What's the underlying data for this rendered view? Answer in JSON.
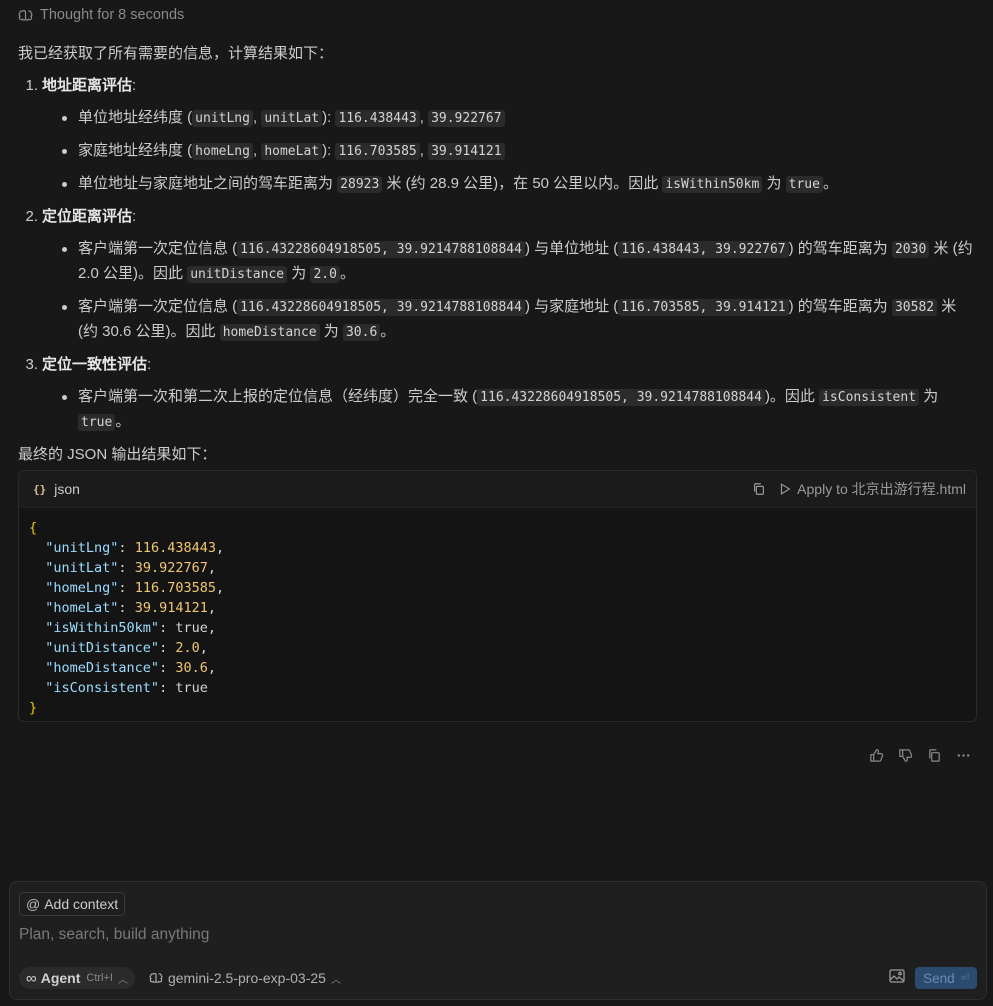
{
  "thought": {
    "label": "Thought for 8 seconds"
  },
  "response": {
    "intro": "我已经获取了所有需要的信息，计算结果如下：",
    "sections": [
      {
        "number": "1.",
        "title": "地址距离评估",
        "colon": ":",
        "items": [
          {
            "parts": [
              {
                "t": "单位地址经纬度 (",
                "c": false
              },
              {
                "t": "unitLng",
                "c": true
              },
              {
                "t": ", ",
                "c": false
              },
              {
                "t": "unitLat",
                "c": true
              },
              {
                "t": "): ",
                "c": false
              },
              {
                "t": "116.438443",
                "c": true
              },
              {
                "t": ", ",
                "c": false
              },
              {
                "t": "39.922767",
                "c": true
              }
            ]
          },
          {
            "parts": [
              {
                "t": "家庭地址经纬度 (",
                "c": false
              },
              {
                "t": "homeLng",
                "c": true
              },
              {
                "t": ", ",
                "c": false
              },
              {
                "t": "homeLat",
                "c": true
              },
              {
                "t": "): ",
                "c": false
              },
              {
                "t": "116.703585",
                "c": true
              },
              {
                "t": ", ",
                "c": false
              },
              {
                "t": "39.914121",
                "c": true
              }
            ]
          },
          {
            "parts": [
              {
                "t": "单位地址与家庭地址之间的驾车距离为 ",
                "c": false
              },
              {
                "t": "28923",
                "c": true
              },
              {
                "t": " 米 (约 28.9 公里)，在 50 公里以内。因此 ",
                "c": false
              },
              {
                "t": "isWithin50km",
                "c": true
              },
              {
                "t": " 为 ",
                "c": false
              },
              {
                "t": "true",
                "c": true
              },
              {
                "t": "。",
                "c": false
              }
            ]
          }
        ]
      },
      {
        "number": "2.",
        "title": "定位距离评估",
        "colon": ":",
        "items": [
          {
            "parts": [
              {
                "t": "客户端第一次定位信息 (",
                "c": false
              },
              {
                "t": "116.43228604918505, 39.9214788108844",
                "c": true
              },
              {
                "t": ") 与单位地址 (",
                "c": false
              },
              {
                "t": "116.438443, 39.922767",
                "c": true
              },
              {
                "t": ") 的驾车距离为 ",
                "c": false
              },
              {
                "t": "2030",
                "c": true
              },
              {
                "t": " 米 (约 2.0 公里)。因此 ",
                "c": false
              },
              {
                "t": "unitDistance",
                "c": true
              },
              {
                "t": " 为 ",
                "c": false
              },
              {
                "t": "2.0",
                "c": true
              },
              {
                "t": "。",
                "c": false
              }
            ]
          },
          {
            "parts": [
              {
                "t": "客户端第一次定位信息 (",
                "c": false
              },
              {
                "t": "116.43228604918505, 39.9214788108844",
                "c": true
              },
              {
                "t": ") 与家庭地址 (",
                "c": false
              },
              {
                "t": "116.703585, 39.914121",
                "c": true
              },
              {
                "t": ") 的驾车距离为 ",
                "c": false
              },
              {
                "t": "30582",
                "c": true
              },
              {
                "t": " 米 (约 30.6 公里)。因此 ",
                "c": false
              },
              {
                "t": "homeDistance",
                "c": true
              },
              {
                "t": " 为 ",
                "c": false
              },
              {
                "t": "30.6",
                "c": true
              },
              {
                "t": "。",
                "c": false
              }
            ]
          }
        ]
      },
      {
        "number": "3.",
        "title": "定位一致性评估",
        "colon": ":",
        "items": [
          {
            "parts": [
              {
                "t": "客户端第一次和第二次上报的定位信息（经纬度）完全一致 (",
                "c": false
              },
              {
                "t": "116.43228604918505, 39.9214788108844",
                "c": true
              },
              {
                "t": ")。因此 ",
                "c": false
              },
              {
                "t": "isConsistent",
                "c": true
              },
              {
                "t": " 为 ",
                "c": false
              },
              {
                "t": "true",
                "c": true
              },
              {
                "t": "。",
                "c": false
              }
            ]
          }
        ]
      }
    ],
    "outro": "最终的 JSON 输出结果如下："
  },
  "code_block": {
    "lang_icon": "{}",
    "language": "json",
    "apply_label": "Apply to 北京出游行程.html",
    "open_brace": "{",
    "close_brace": "}",
    "entries": [
      {
        "key": "\"unitLng\"",
        "value": "116.438443",
        "type": "num",
        "comma": ","
      },
      {
        "key": "\"unitLat\"",
        "value": "39.922767",
        "type": "num",
        "comma": ","
      },
      {
        "key": "\"homeLng\"",
        "value": "116.703585",
        "type": "num",
        "comma": ","
      },
      {
        "key": "\"homeLat\"",
        "value": "39.914121",
        "type": "num",
        "comma": ","
      },
      {
        "key": "\"isWithin50km\"",
        "value": "true",
        "type": "bool",
        "comma": ","
      },
      {
        "key": "\"unitDistance\"",
        "value": "2.0",
        "type": "num",
        "comma": ","
      },
      {
        "key": "\"homeDistance\"",
        "value": "30.6",
        "type": "num",
        "comma": ","
      },
      {
        "key": "\"isConsistent\"",
        "value": "true",
        "type": "bool",
        "comma": ""
      }
    ]
  },
  "message_actions": [
    "thumbs-up-icon",
    "thumbs-down-icon",
    "copy-icon",
    "more-icon"
  ],
  "composer": {
    "add_context_icon": "@",
    "add_context_label": "Add context",
    "placeholder": "Plan, search, build anything",
    "agent_icon": "∞",
    "agent_label": "Agent",
    "agent_shortcut": "Ctrl+I",
    "model_label": "gemini-2.5-pro-exp-03-25",
    "send_label": "Send",
    "send_shortcut": "⏎"
  }
}
